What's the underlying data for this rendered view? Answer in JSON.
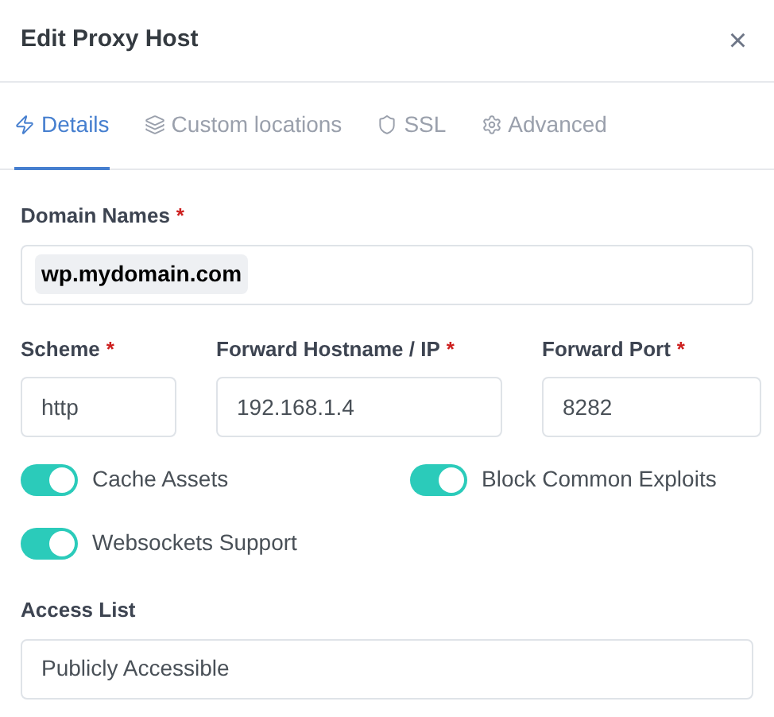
{
  "dialog": {
    "title": "Edit Proxy Host",
    "close": "×"
  },
  "tabs": [
    {
      "label": "Details",
      "kind": "bolt",
      "selected": true
    },
    {
      "label": "Custom locations",
      "kind": "layers",
      "selected": false
    },
    {
      "label": "SSL",
      "kind": "shield",
      "selected": false
    },
    {
      "label": "Advanced",
      "kind": "gear",
      "selected": false
    }
  ],
  "domain_names": {
    "label": "Domain Names",
    "required": "*",
    "tags": [
      "wp.mydomain.com"
    ]
  },
  "fields": [
    {
      "label": "Scheme",
      "required": "*",
      "value": "http"
    },
    {
      "label": "Forward Hostname / IP",
      "required": "*",
      "value": "192.168.1.4"
    },
    {
      "label": "Forward Port",
      "required": "*",
      "value": "8282"
    }
  ],
  "toggles": [
    {
      "label": "Cache Assets",
      "on": true
    },
    {
      "label": "Block Common Exploits",
      "on": true
    },
    {
      "label": "Websockets Support",
      "on": true
    }
  ],
  "access_list": {
    "label": "Access List",
    "value": "Publicly Accessible"
  }
}
